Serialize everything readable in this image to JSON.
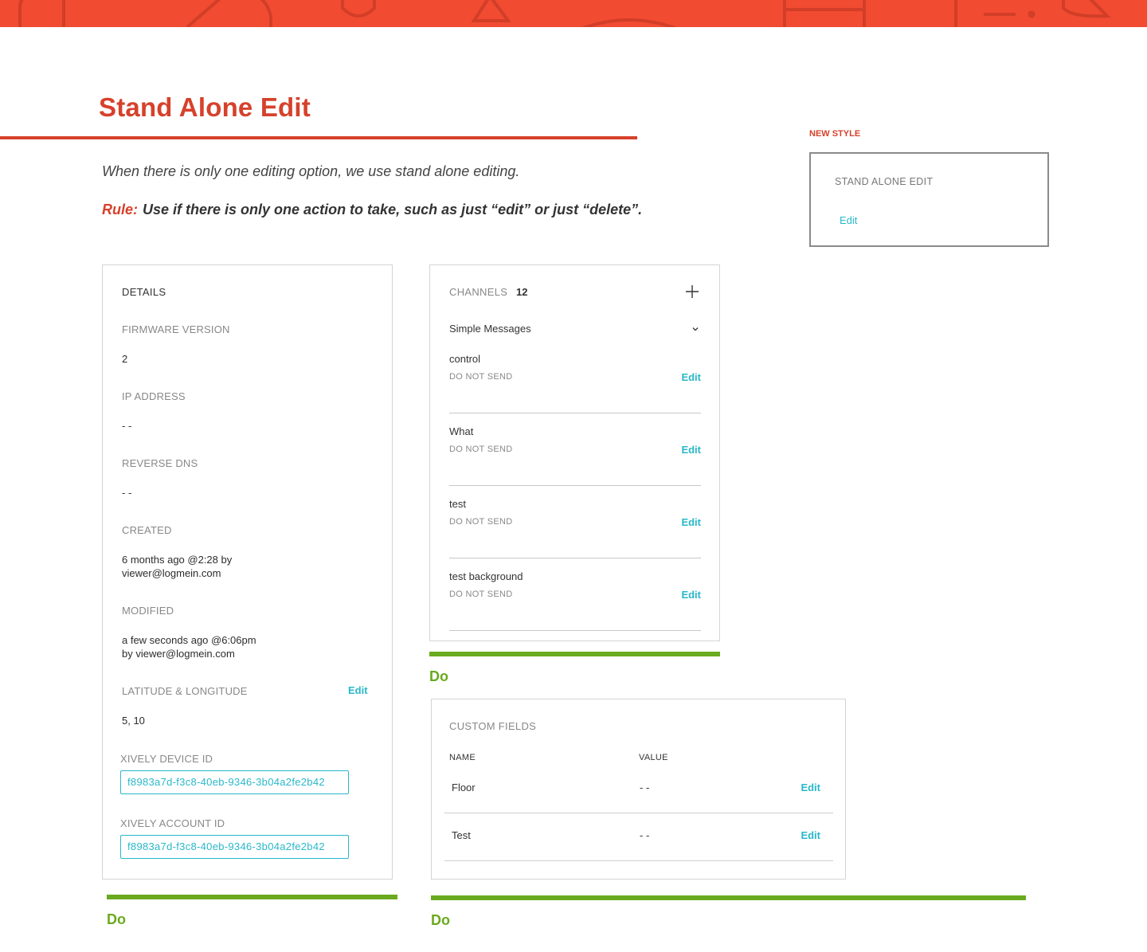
{
  "page": {
    "title": "Stand Alone Edit",
    "intro": "When there is only one editing option, we use stand alone editing.",
    "rule_label": "Rule:",
    "rule_text": "Use if there is only one action to take, such as just “edit” or just “delete”."
  },
  "new_style": {
    "label": "NEW STYLE",
    "heading": "STAND ALONE EDIT",
    "edit_label": "Edit"
  },
  "details": {
    "heading": "DETAILS",
    "firmware_label": "FIRMWARE VERSION",
    "firmware_value": "2",
    "ip_label": "IP ADDRESS",
    "ip_value": "- -",
    "dns_label": "REVERSE DNS",
    "dns_value": "- -",
    "created_label": "CREATED",
    "created_line1": "6 months ago @2:28 by",
    "created_line2": "viewer@logmein.com",
    "modified_label": "MODIFIED",
    "modified_line1": "a few seconds ago @6:06pm",
    "modified_line2": "by viewer@logmein.com",
    "latlong_label": "LATITUDE & LONGITUDE",
    "latlong_edit": "Edit",
    "latlong_value": "5, 10",
    "device_id_label": "XIVELY DEVICE ID",
    "device_id_value": "f8983a7d-f3c8-40eb-9346-3b04a2fe2b42",
    "account_id_label": "XIVELY ACCOUNT ID",
    "account_id_value": "f8983a7d-f3c8-40eb-9346-3b04a2fe2b42"
  },
  "channels": {
    "heading": "CHANNELS",
    "count": "12",
    "dropdown_value": "Simple Messages",
    "rows": [
      {
        "name": "control",
        "status": "DO NOT SEND",
        "edit": "Edit"
      },
      {
        "name": "What",
        "status": "DO NOT SEND",
        "edit": "Edit"
      },
      {
        "name": "test",
        "status": "DO NOT SEND",
        "edit": "Edit"
      },
      {
        "name": "test background",
        "status": "DO NOT SEND",
        "edit": "Edit"
      }
    ]
  },
  "custom_fields": {
    "heading": "CUSTOM FIELDS",
    "col_name": "NAME",
    "col_value": "VALUE",
    "rows": [
      {
        "name": "Floor",
        "value": "- -",
        "edit": "Edit"
      },
      {
        "name": "Test",
        "value": "- -",
        "edit": "Edit"
      }
    ]
  },
  "do_labels": {
    "channels": "Do",
    "details": "Do",
    "custom_fields": "Do"
  },
  "colors": {
    "brand_red": "#d6412b",
    "banner": "#f14b32",
    "accent_teal": "#2ab8c9",
    "do_green": "#6aaa1e"
  }
}
